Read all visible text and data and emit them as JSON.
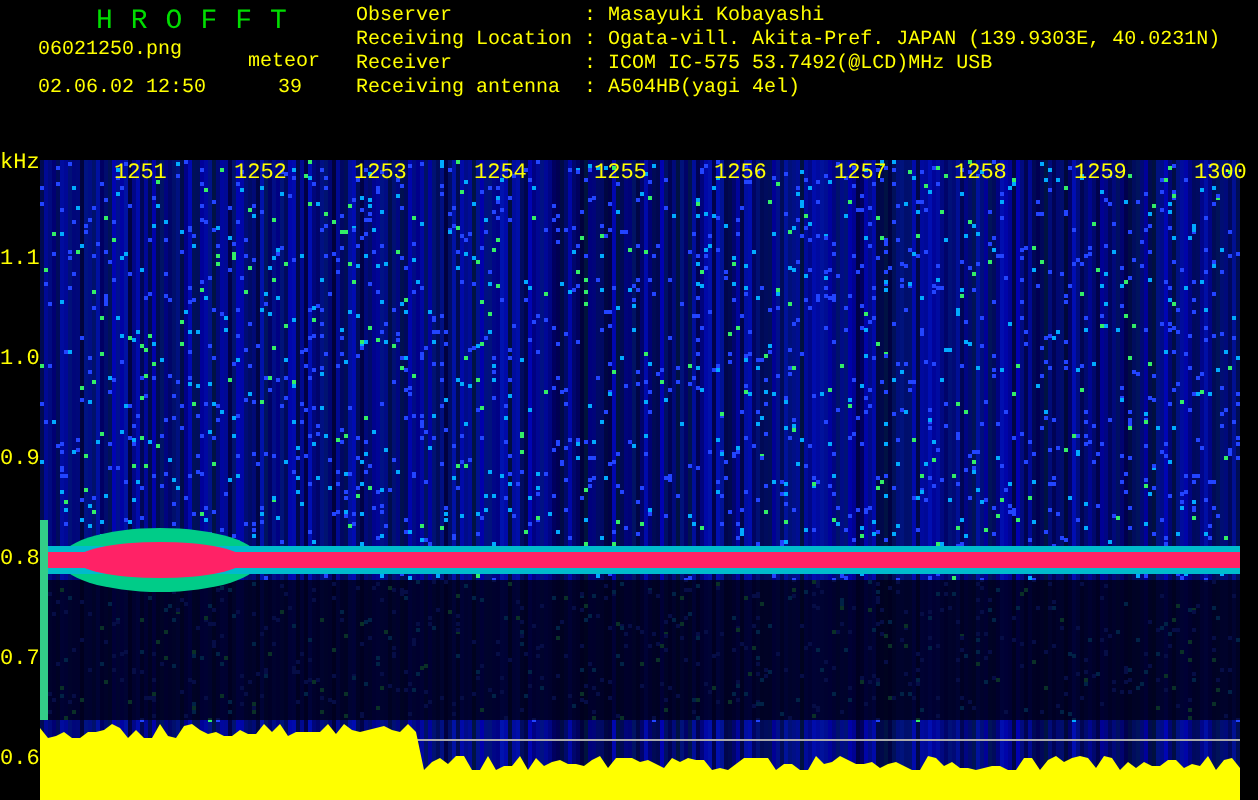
{
  "app_title": "HROFFT",
  "file_name": "06021250.png",
  "timestamp": "02.06.02 12:50",
  "meteor": {
    "label": "meteor",
    "count": "39"
  },
  "station_info": [
    {
      "label": "Observer",
      "separator": ":",
      "value": "Masayuki Kobayashi"
    },
    {
      "label": "Receiving Location",
      "separator": ":",
      "value": "Ogata-vill. Akita-Pref. JAPAN (139.9303E, 40.0231N)"
    },
    {
      "label": "Receiver",
      "separator": ":",
      "value": "ICOM IC-575 53.7492(@LCD)MHz USB"
    },
    {
      "label": "Receiving antenna",
      "separator": ":",
      "value": "A504HB(yagi 4el)"
    }
  ],
  "y_axis": {
    "unit": "kHz",
    "labels": [
      "1.1",
      "1.0",
      "0.9",
      "0.8",
      "0.7",
      "0.6"
    ]
  },
  "time_labels": [
    "1251",
    "1252",
    "1253",
    "1254",
    "1255",
    "1256",
    "1257",
    "1258",
    "1259",
    "1300"
  ]
}
